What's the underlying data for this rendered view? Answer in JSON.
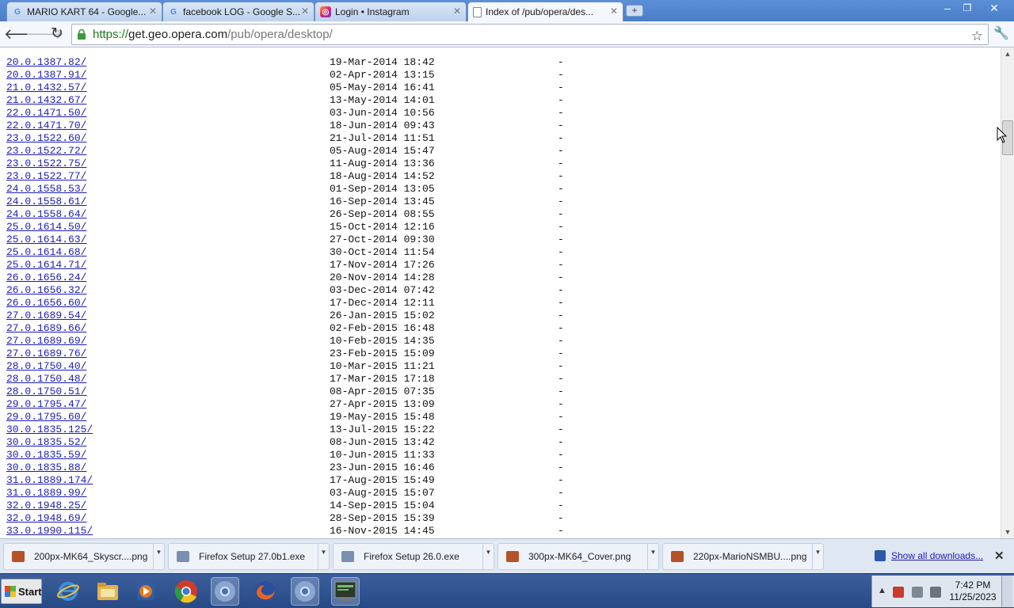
{
  "browser": {
    "tabs": [
      {
        "title": "MARIO KART 64 - Google...",
        "icon": "google-icon",
        "active": false
      },
      {
        "title": "facebook LOG - Google S...",
        "icon": "google-icon",
        "active": false
      },
      {
        "title": "Login • Instagram",
        "icon": "instagram-icon",
        "active": false
      },
      {
        "title": "Index of /pub/opera/des...",
        "icon": "page-icon",
        "active": true
      }
    ],
    "new_tab_label": "+",
    "url": {
      "scheme": "https://",
      "host": "get.geo.opera.com",
      "path": "/pub/opera/desktop/"
    },
    "window_controls": {
      "minimize": "–",
      "restore": "❐",
      "close": "✕"
    }
  },
  "listing": {
    "rows": [
      {
        "name": "20.0.1387.82/",
        "date": "19-Mar-2014 18:42",
        "size": "-"
      },
      {
        "name": "20.0.1387.91/",
        "date": "02-Apr-2014 13:15",
        "size": "-"
      },
      {
        "name": "21.0.1432.57/",
        "date": "05-May-2014 16:41",
        "size": "-"
      },
      {
        "name": "21.0.1432.67/",
        "date": "13-May-2014 14:01",
        "size": "-"
      },
      {
        "name": "22.0.1471.50/",
        "date": "03-Jun-2014 10:56",
        "size": "-"
      },
      {
        "name": "22.0.1471.70/",
        "date": "18-Jun-2014 09:43",
        "size": "-"
      },
      {
        "name": "23.0.1522.60/",
        "date": "21-Jul-2014 11:51",
        "size": "-"
      },
      {
        "name": "23.0.1522.72/",
        "date": "05-Aug-2014 15:47",
        "size": "-"
      },
      {
        "name": "23.0.1522.75/",
        "date": "11-Aug-2014 13:36",
        "size": "-"
      },
      {
        "name": "23.0.1522.77/",
        "date": "18-Aug-2014 14:52",
        "size": "-"
      },
      {
        "name": "24.0.1558.53/",
        "date": "01-Sep-2014 13:05",
        "size": "-"
      },
      {
        "name": "24.0.1558.61/",
        "date": "16-Sep-2014 13:45",
        "size": "-"
      },
      {
        "name": "24.0.1558.64/",
        "date": "26-Sep-2014 08:55",
        "size": "-"
      },
      {
        "name": "25.0.1614.50/",
        "date": "15-Oct-2014 12:16",
        "size": "-"
      },
      {
        "name": "25.0.1614.63/",
        "date": "27-Oct-2014 09:30",
        "size": "-"
      },
      {
        "name": "25.0.1614.68/",
        "date": "30-Oct-2014 11:54",
        "size": "-"
      },
      {
        "name": "25.0.1614.71/",
        "date": "17-Nov-2014 17:26",
        "size": "-"
      },
      {
        "name": "26.0.1656.24/",
        "date": "20-Nov-2014 14:28",
        "size": "-"
      },
      {
        "name": "26.0.1656.32/",
        "date": "03-Dec-2014 07:42",
        "size": "-"
      },
      {
        "name": "26.0.1656.60/",
        "date": "17-Dec-2014 12:11",
        "size": "-"
      },
      {
        "name": "27.0.1689.54/",
        "date": "26-Jan-2015 15:02",
        "size": "-"
      },
      {
        "name": "27.0.1689.66/",
        "date": "02-Feb-2015 16:48",
        "size": "-"
      },
      {
        "name": "27.0.1689.69/",
        "date": "10-Feb-2015 14:35",
        "size": "-"
      },
      {
        "name": "27.0.1689.76/",
        "date": "23-Feb-2015 15:09",
        "size": "-"
      },
      {
        "name": "28.0.1750.40/",
        "date": "10-Mar-2015 11:21",
        "size": "-"
      },
      {
        "name": "28.0.1750.48/",
        "date": "17-Mar-2015 17:18",
        "size": "-"
      },
      {
        "name": "28.0.1750.51/",
        "date": "08-Apr-2015 07:35",
        "size": "-"
      },
      {
        "name": "29.0.1795.47/",
        "date": "27-Apr-2015 13:09",
        "size": "-"
      },
      {
        "name": "29.0.1795.60/",
        "date": "19-May-2015 15:48",
        "size": "-"
      },
      {
        "name": "30.0.1835.125/",
        "date": "13-Jul-2015 15:22",
        "size": "-"
      },
      {
        "name": "30.0.1835.52/",
        "date": "08-Jun-2015 13:42",
        "size": "-"
      },
      {
        "name": "30.0.1835.59/",
        "date": "10-Jun-2015 11:33",
        "size": "-"
      },
      {
        "name": "30.0.1835.88/",
        "date": "23-Jun-2015 16:46",
        "size": "-"
      },
      {
        "name": "31.0.1889.174/",
        "date": "17-Aug-2015 15:49",
        "size": "-"
      },
      {
        "name": "31.0.1889.99/",
        "date": "03-Aug-2015 15:07",
        "size": "-"
      },
      {
        "name": "32.0.1948.25/",
        "date": "14-Sep-2015 15:04",
        "size": "-"
      },
      {
        "name": "32.0.1948.69/",
        "date": "28-Sep-2015 15:39",
        "size": "-"
      },
      {
        "name": "33.0.1990.115/",
        "date": "16-Nov-2015 14:45",
        "size": "-"
      }
    ]
  },
  "downloads": {
    "items": [
      {
        "name": "200px-MK64_Skyscr....png",
        "icon": "image-file-icon",
        "color": "#b5522a"
      },
      {
        "name": "Firefox Setup 27.0b1.exe",
        "icon": "installer-icon",
        "color": "#7a8fb0"
      },
      {
        "name": "Firefox Setup 26.0.exe",
        "icon": "installer-icon",
        "color": "#7a8fb0"
      },
      {
        "name": "300px-MK64_Cover.png",
        "icon": "image-file-icon",
        "color": "#b5522a"
      },
      {
        "name": "220px-MarioNSMBU....png",
        "icon": "image-file-icon",
        "color": "#b5522a"
      }
    ],
    "show_all": "Show all downloads...",
    "close": "✕"
  },
  "taskbar": {
    "start_label": "Start",
    "apps": [
      {
        "name": "internet-explorer-icon",
        "color": "#2a78d0"
      },
      {
        "name": "file-explorer-icon",
        "color": "#e2b44a"
      },
      {
        "name": "media-player-icon",
        "color": "#e07a1f"
      },
      {
        "name": "chrome-icon",
        "color": "#d23b2a"
      },
      {
        "name": "chrome-icon",
        "color": "#6a8fc9"
      },
      {
        "name": "firefox-icon",
        "color": "#e8661a"
      },
      {
        "name": "chrome-icon",
        "color": "#6a8fc9"
      },
      {
        "name": "terminal-icon",
        "color": "#3a5a3a"
      }
    ],
    "clock_time": "7:42 PM",
    "clock_date": "11/25/2023"
  },
  "colors": {
    "link": "#1b1bb5",
    "secure_host": "#1f7a1f",
    "taskbar": "#274a86"
  }
}
